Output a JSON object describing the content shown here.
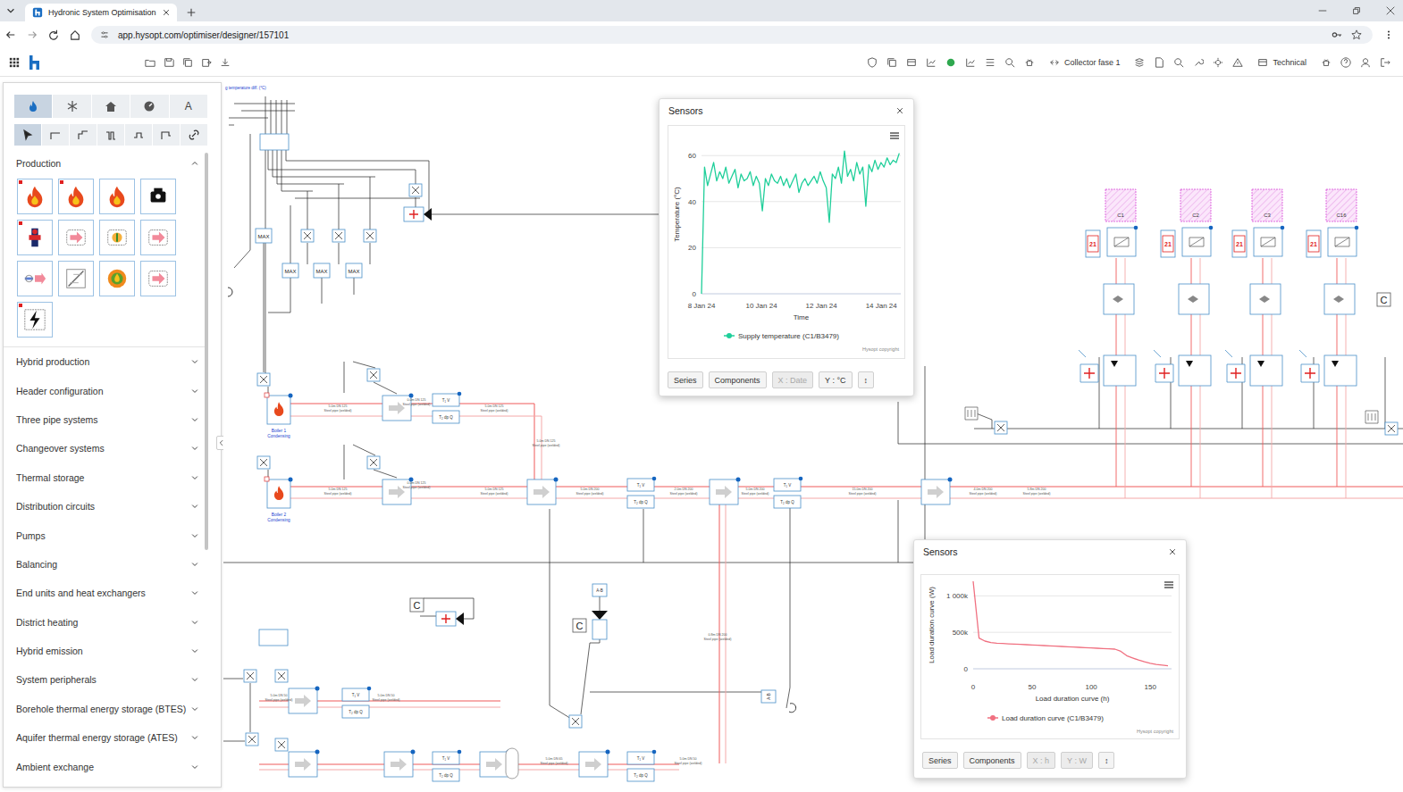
{
  "browser": {
    "tab_title": "Hydronic System Optimisation",
    "url": "app.hysopt.com/optimiser/designer/157101"
  },
  "toolbar": {
    "collector": "Collector fase 1",
    "view": "Technical"
  },
  "sidebar": {
    "tabs": [
      {
        "selected": true
      },
      {
        "selected": false
      },
      {
        "selected": false
      },
      {
        "selected": false
      },
      {
        "selected": false,
        "label": "A"
      }
    ],
    "tools": [
      {
        "selected": true
      },
      {
        "selected": false
      },
      {
        "selected": false
      },
      {
        "selected": false
      },
      {
        "selected": false
      },
      {
        "selected": false
      },
      {
        "selected": false
      }
    ],
    "sections": [
      {
        "title": "Production",
        "expanded": true
      },
      {
        "title": "Hybrid production",
        "expanded": false
      },
      {
        "title": "Header configuration",
        "expanded": false
      },
      {
        "title": "Three pipe systems",
        "expanded": false
      },
      {
        "title": "Changeover systems",
        "expanded": false
      },
      {
        "title": "Thermal storage",
        "expanded": false
      },
      {
        "title": "Distribution circuits",
        "expanded": false
      },
      {
        "title": "Pumps",
        "expanded": false
      },
      {
        "title": "Balancing",
        "expanded": false
      },
      {
        "title": "End units and heat exchangers",
        "expanded": false
      },
      {
        "title": "District heating",
        "expanded": false
      },
      {
        "title": "Hybrid emission",
        "expanded": false
      },
      {
        "title": "System peripherals",
        "expanded": false
      },
      {
        "title": "Borehole thermal energy storage (BTES)",
        "expanded": false
      },
      {
        "title": "Aquifer thermal energy storage (ATES)",
        "expanded": false
      },
      {
        "title": "Ambient exchange",
        "expanded": false
      }
    ],
    "tiles": [
      {
        "flagged": true
      },
      {
        "flagged": true
      },
      {
        "flagged": false
      },
      {
        "flagged": false
      },
      {
        "flagged": true
      },
      {
        "flagged": false
      },
      {
        "flagged": false
      },
      {
        "flagged": false
      },
      {
        "flagged": false
      },
      {
        "flagged": false
      },
      {
        "flagged": false
      },
      {
        "flagged": false
      },
      {
        "flagged": true
      }
    ]
  },
  "diagram": {
    "header_label": "g temperature diff. (°C)",
    "boilers": [
      {
        "name": "Boiler 1",
        "type": "Condensing"
      },
      {
        "name": "Boiler 2",
        "type": "Condensing"
      }
    ],
    "max_blocks": [
      "MAX",
      "MAX",
      "MAX",
      "MAX"
    ],
    "circuits": [
      {
        "name": "C1",
        "setpoint": "21"
      },
      {
        "name": "C2",
        "setpoint": "21"
      },
      {
        "name": "C3",
        "setpoint": "21"
      },
      {
        "name": "C16",
        "setpoint": "21"
      }
    ],
    "c_blocks": [
      "C",
      "C",
      "C"
    ],
    "valve_labels": [
      "A-B",
      "A-B"
    ],
    "sensor_labels": [
      {
        "top": "T₁ V",
        "bottom": "T₂ dp Q"
      },
      {
        "top": "T₁ V",
        "bottom": "T₂ dp Q"
      },
      {
        "top": "T₁ V",
        "bottom": "T₂ dp Q"
      },
      {
        "top": "T₁ V",
        "bottom": "T₂ dp Q"
      },
      {
        "top": "T₁ V",
        "bottom": "T₂ dp Q"
      },
      {
        "top": "T₁ V",
        "bottom": "T₂ dp Q"
      }
    ],
    "pipe_labels": [
      {
        "size": "5.0m DN 125",
        "material": "Steel pipe (welded)"
      },
      {
        "size": "0.0m DN 125",
        "material": "Steel pipe (welded)"
      },
      {
        "size": "5.0m DN 125",
        "material": "Steel pipe (welded)"
      },
      {
        "size": "5.0m DN 125",
        "material": "Steel pipe (welded)"
      },
      {
        "size": "0.0m DN 125",
        "material": "Steel pipe (welded)"
      },
      {
        "size": "5.0m DN 125",
        "material": "Steel pipe (welded)"
      },
      {
        "size": "5.0m DN 200",
        "material": "Steel pipe (welded)"
      },
      {
        "size": "2.0m DN 200",
        "material": "Steel pipe (welded)"
      },
      {
        "size": "5.0m DN 200",
        "material": "Steel pipe (welded)"
      },
      {
        "size": "15.0m DN 200",
        "material": "Steel pipe (welded)"
      },
      {
        "size": "4.0m DN 200",
        "material": "Steel pipe (welded)"
      },
      {
        "size": "5.8m DN 200",
        "material": "Steel pipe (welded)"
      },
      {
        "size": "5.0m DN 125",
        "material": "Steel pipe (welded)"
      },
      {
        "size": "0.8m DN 200",
        "material": "Steel pipe (welded)"
      },
      {
        "size": "5.0m DN 50",
        "material": "Steel pipe (welded)"
      },
      {
        "size": "5.0m DN 50",
        "material": "Steel pipe (welded)"
      },
      {
        "size": "5.0m DN 65",
        "material": "Steel pipe (welded)"
      },
      {
        "size": "5.0m DN 50",
        "material": "Steel pipe (welded)"
      }
    ]
  },
  "sensor_windows": [
    {
      "title": "Sensors",
      "chart": {
        "y_title": "Temperature (°C)",
        "x_title": "Time",
        "y_ticks": [
          "0",
          "20",
          "40",
          "60"
        ],
        "x_ticks": [
          "8 Jan 24",
          "10 Jan 24",
          "12 Jan 24",
          "14 Jan 24"
        ],
        "copyright": "Hysopt copyright",
        "series": {
          "name": "Supply temperature (C1/B3479)",
          "color": "#1fcf9a",
          "values": [
            0,
            55,
            47,
            52,
            57,
            49,
            53,
            50,
            55,
            48,
            51,
            54,
            46,
            52,
            49,
            50,
            53,
            47,
            51,
            48,
            36,
            50,
            47,
            52,
            49,
            48,
            51,
            47,
            50,
            46,
            49,
            52,
            44,
            48,
            50,
            47,
            49,
            51,
            48,
            53,
            49,
            46,
            31,
            52,
            50,
            55,
            48,
            62,
            51,
            54,
            49,
            57,
            52,
            55,
            38,
            56,
            53,
            58,
            54,
            57,
            55,
            59,
            56,
            58,
            57,
            61
          ]
        }
      },
      "buttons": [
        {
          "label": "Series",
          "disabled": false
        },
        {
          "label": "Components",
          "disabled": false
        },
        {
          "label": "X : Date",
          "disabled": true
        },
        {
          "label": "Y : °C",
          "disabled": false
        },
        {
          "label": "↕",
          "disabled": false
        }
      ]
    },
    {
      "title": "Sensors",
      "chart": {
        "y_title": "Load duration curve (W)",
        "x_title": "Load duration curve (h)",
        "y_ticks": [
          "0",
          "500k",
          "1 000k"
        ],
        "x_ticks": [
          "0",
          "50",
          "100",
          "150"
        ],
        "copyright": "Hysopt copyright",
        "series": {
          "name": "Load duration curve (C1/B3479)",
          "color": "#f07080",
          "values": [
            1200000,
            420000,
            380000,
            360000,
            350000,
            346000,
            342000,
            338000,
            334000,
            330000,
            326000,
            322000,
            318000,
            314000,
            310000,
            306000,
            302000,
            298000,
            294000,
            290000,
            286000,
            282000,
            278000,
            274000,
            270000,
            240000,
            180000,
            150000,
            120000,
            95000,
            75000,
            60000,
            50000,
            40000
          ]
        }
      },
      "buttons": [
        {
          "label": "Series",
          "disabled": false
        },
        {
          "label": "Components",
          "disabled": false
        },
        {
          "label": "X : h",
          "disabled": true
        },
        {
          "label": "Y : W",
          "disabled": true
        },
        {
          "label": "↕",
          "disabled": false
        }
      ]
    }
  ]
}
